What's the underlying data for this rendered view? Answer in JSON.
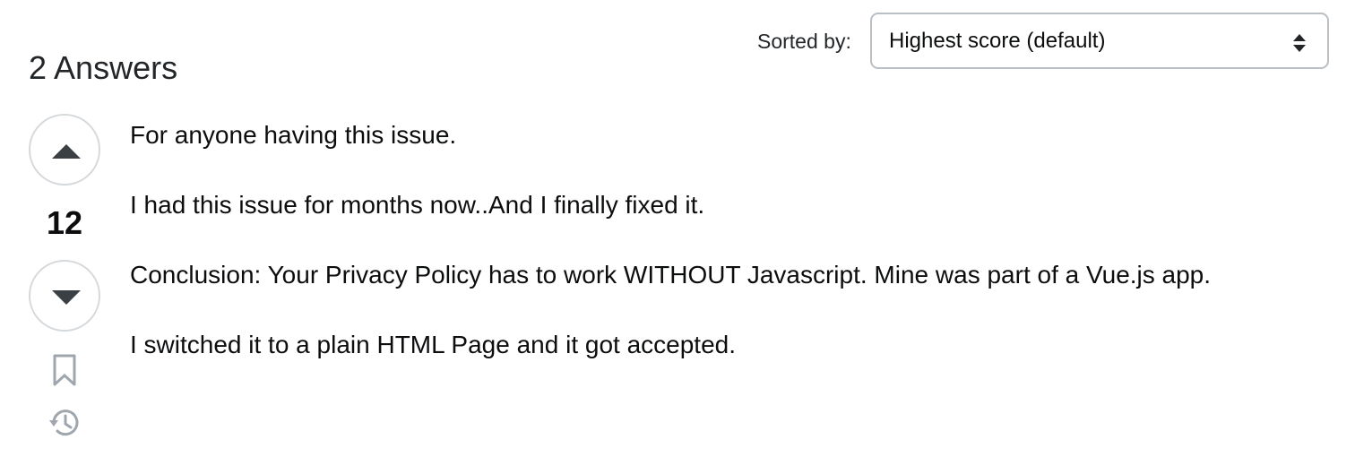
{
  "header": {
    "answers_count_label": "2 Answers",
    "sort_label": "Sorted by:",
    "sort_selected": "Highest score (default)"
  },
  "answer": {
    "score": "12",
    "paragraphs": [
      "For anyone having this issue.",
      "I had this issue for months now..And I finally fixed it.",
      "Conclusion: Your Privacy Policy has to work WITHOUT Javascript. Mine was part of a Vue.js app.",
      "I switched it to a plain HTML Page and it got accepted."
    ]
  },
  "icons": {
    "upvote": "arrow-up-icon",
    "downvote": "arrow-down-icon",
    "bookmark": "bookmark-icon",
    "history": "history-icon",
    "sort_arrows": "chevron-up-down-icon"
  },
  "colors": {
    "text": "#0c0d0e",
    "border": "#babfc4",
    "icon": "#9fa6ad",
    "arrow": "#3b4045"
  }
}
